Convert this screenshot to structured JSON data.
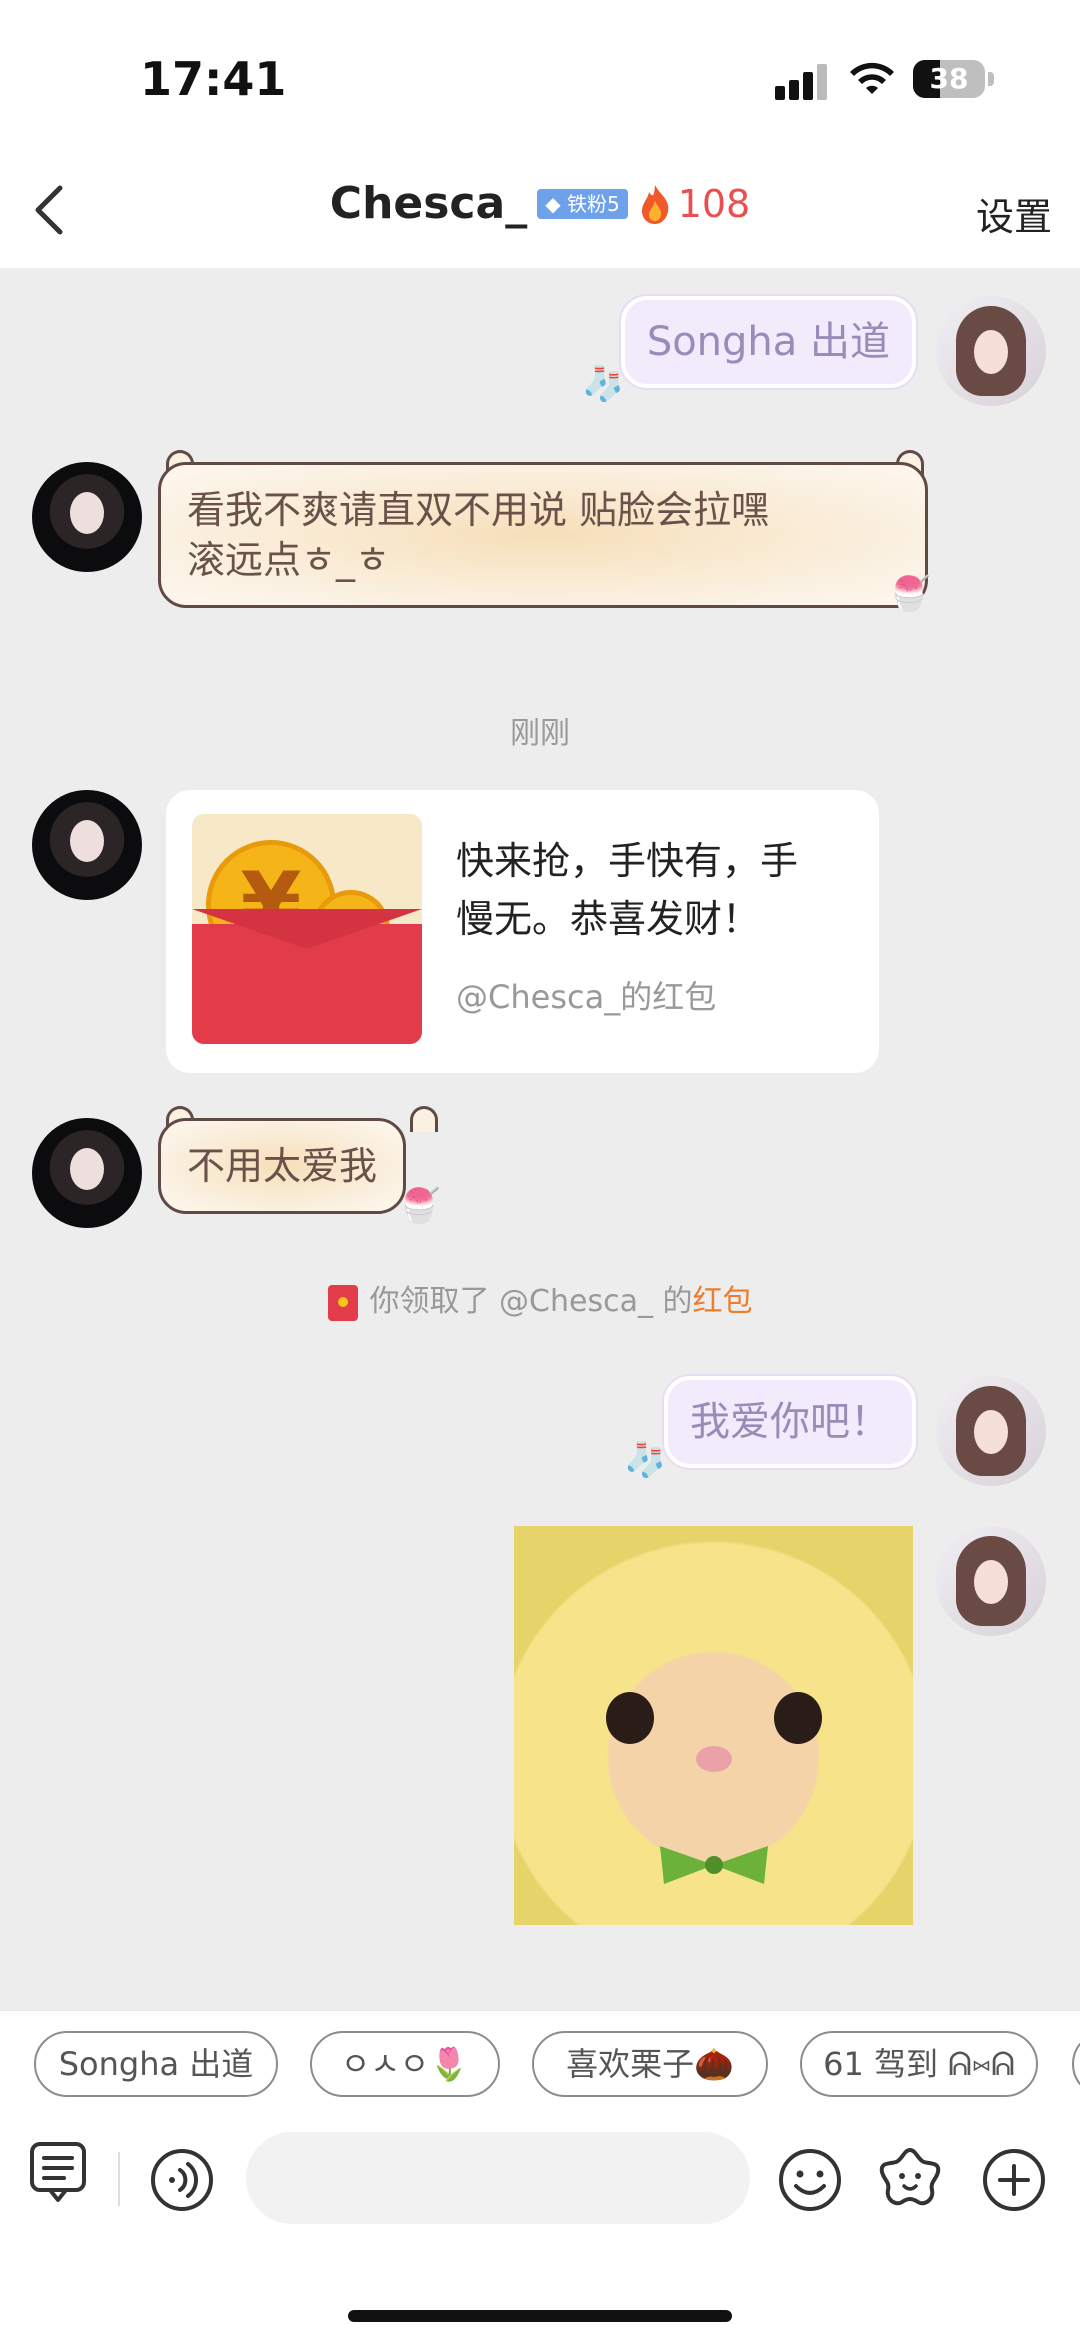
{
  "status_bar": {
    "time": "17:41",
    "battery": "38",
    "battery_level": 0.38
  },
  "header": {
    "title": "Chesca_",
    "fan_badge": "铁粉5",
    "streak_count": "108",
    "settings_label": "设置"
  },
  "messages": [
    {
      "side": "right",
      "text": "Songha 出道"
    },
    {
      "side": "left",
      "text_line1": "看我不爽请直双不用说 贴脸会拉嘿",
      "text_line2": "滚远点ㅎ_ㅎ"
    },
    {
      "type": "timestamp",
      "text": "刚刚"
    },
    {
      "side": "left",
      "type": "red_packet",
      "text_line1": "快来抢，手快有，手",
      "text_line2": "慢无。恭喜发财！",
      "from": "@Chesca_的红包"
    },
    {
      "side": "left",
      "text": "不用太爱我"
    },
    {
      "type": "system",
      "prefix": "你领取了 @Chesca_ 的",
      "link": "红包"
    },
    {
      "side": "right",
      "text": "我爱你吧！"
    },
    {
      "side": "right",
      "type": "image",
      "description": "cat-in-banana-hood"
    }
  ],
  "quick_replies": [
    "Songha 出道",
    "ㅇㅅㅇ🌷",
    "喜欢栗子🌰",
    "61 驾到 ᕱ⑅ᕱ"
  ],
  "colors": {
    "accent_red": "#e23c4a",
    "link_orange": "#f07b2b",
    "streak_red": "#e94f4f",
    "badge_blue": "#6fa1ea"
  }
}
